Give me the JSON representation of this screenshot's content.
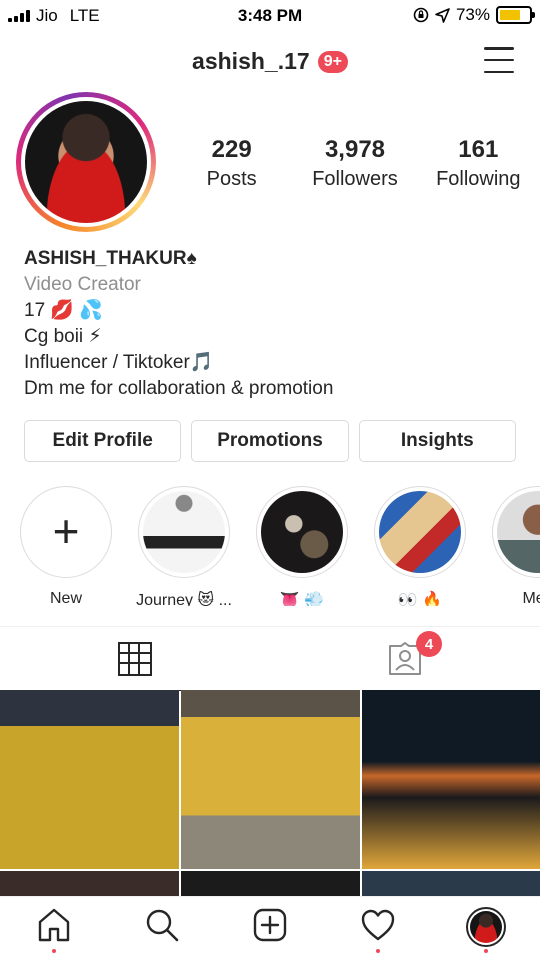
{
  "status_bar": {
    "carrier": "Jio",
    "network": "LTE",
    "time": "3:48 PM",
    "battery_percent": "73%",
    "battery_level": 0.73
  },
  "header": {
    "username": "ashish_.17",
    "notification_badge": "9+"
  },
  "profile": {
    "stats": [
      {
        "value": "229",
        "label": "Posts"
      },
      {
        "value": "3,978",
        "label": "Followers"
      },
      {
        "value": "161",
        "label": "Following"
      }
    ],
    "name": "ASHISH_THAKUR♠",
    "category": "Video Creator",
    "bio": [
      "17 💋 💦",
      "Cg boii ⚡",
      "Influencer / Tiktoker🎵",
      "Dm me for collaboration & promotion"
    ]
  },
  "buttons": {
    "edit_profile": "Edit Profile",
    "promotions": "Promotions",
    "insights": "Insights"
  },
  "highlights": [
    {
      "label": "New",
      "plus": "+"
    },
    {
      "label": "Journey 😻 ..."
    },
    {
      "label": "👅 💨"
    },
    {
      "label": "👀 🔥"
    },
    {
      "label": "Meh"
    }
  ],
  "tabs": {
    "tagged_badge": "4"
  },
  "colors": {
    "accent_red": "#ed4956",
    "text": "#262626",
    "secondary_text": "#8e8e8e",
    "border": "#dbdbdb"
  }
}
